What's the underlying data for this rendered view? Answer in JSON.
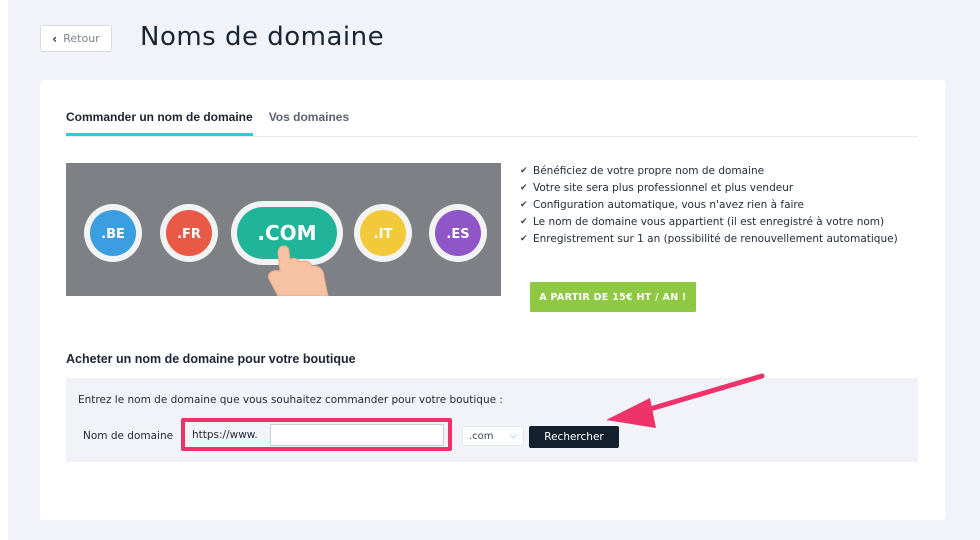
{
  "header": {
    "back_label": "Retour",
    "title": "Noms de domaine"
  },
  "tabs": [
    {
      "label": "Commander un nom de domaine",
      "active": true
    },
    {
      "label": "Vos domaines",
      "active": false
    }
  ],
  "banner": {
    "tlds": [
      {
        "label": ".BE",
        "color": "#3a9ee0"
      },
      {
        "label": ".FR",
        "color": "#e85a46"
      },
      {
        "label": ".COM",
        "color": "#20b59a"
      },
      {
        "label": ".IT",
        "color": "#f3c93c"
      },
      {
        "label": ".ES",
        "color": "#8e56c6"
      }
    ]
  },
  "features": [
    "Bénéficiez de votre propre nom de domaine",
    "Votre site sera plus professionnel et plus vendeur",
    "Configuration automatique, vous n'avez rien à faire",
    "Le nom de domaine vous appartient (il est enregistré à votre nom)",
    "Enregistrement sur 1 an (possibilité de renouvellement automatique)"
  ],
  "price_cta": "A PARTIR DE 15€ HT / AN !",
  "search": {
    "section_title": "Acheter un nom de domaine pour votre boutique",
    "instruction": "Entrez le nom de domaine que vous souhaitez commander pour votre boutique :",
    "field_label": "Nom de domaine",
    "prefix": "https://www.",
    "input_value": "",
    "tld_selected": ".com",
    "button_label": "Rechercher"
  },
  "colors": {
    "accent_tab": "#35c7dd",
    "cta_green": "#8fc842",
    "highlight": "#f0326b",
    "button_dark": "#14202e"
  }
}
